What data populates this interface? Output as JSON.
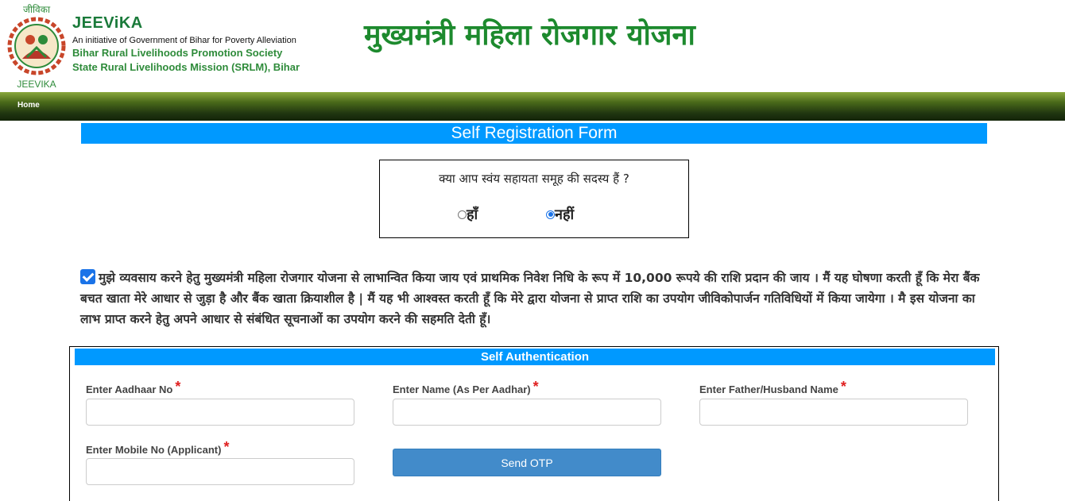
{
  "header": {
    "logo_top_text": "जीविका",
    "logo_bottom_text": "JEEVIKA",
    "brand_name": "JEEViKA",
    "brand_tagline": "An initiative of Government of Bihar for Poverty Alleviation",
    "brand_line1": "Bihar Rural Livelihoods Promotion Society",
    "brand_line2": "State Rural Livelihoods Mission (SRLM), Bihar",
    "title": "मुख्यमंत्री महिला रोजगार योजना"
  },
  "nav": {
    "home_label": "Home"
  },
  "form": {
    "title": "Self Registration Form",
    "shg_question": "क्या आप स्वंय सहायता समूह की सदस्य हैं ?",
    "shg_yes_label": "हाँ",
    "shg_no_label": "नहीं",
    "shg_selected": "नहीं",
    "declaration_checked": true,
    "declaration_text": "मुझे व्यवसाय करने हेतु मुख्यमंत्री महिला रोजगार योजना से लाभान्वित किया जाय एवं प्राथमिक निवेश निधि के रूप में 10,000 रूपये की राशि प्रदान की जाय । मैं यह घोषणा करती हूँ कि मेरा बैंक बचत खाता मेरे आधार से जुड़ा है और बैंक खाता क्रियाशील है | मैं यह भी आश्वस्त करती हूँ कि मेरे द्वारा योजना से प्राप्त राशि का उपयोग जीविकोपार्जन गतिविधियों में किया जायेगा । मै इस योजना का लाभ प्राप्त करने हेतु अपने आधार से संबंधित सूचनाओं का उपयोग करने की सहमति देती हूँ।"
  },
  "auth": {
    "title": "Self Authentication",
    "aadhaar_label": "Enter Aadhaar No",
    "aadhaar_value": "",
    "name_label": "Enter Name (As Per Aadhar)",
    "name_value": "",
    "father_label": "Enter Father/Husband Name",
    "father_value": "",
    "mobile_label": "Enter Mobile No (Applicant)",
    "mobile_value": "",
    "required_mark": "*",
    "send_otp_label": "Send OTP"
  },
  "colors": {
    "accent_blue": "#0099ff",
    "brand_green": "#1d8a2e",
    "button_blue": "#428bca",
    "required_red": "#e02020"
  }
}
